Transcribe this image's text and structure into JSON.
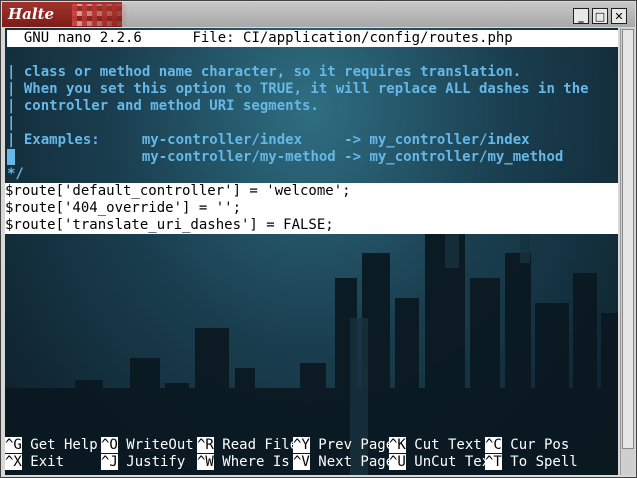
{
  "window": {
    "title": "Halte",
    "min_label": "_",
    "max_label": "□",
    "close_label": "✕"
  },
  "nano": {
    "header_version": "  GNU nano 2.2.6",
    "header_file": "File: CI/application/config/routes.php"
  },
  "comment_lines": [
    "| class or method name character, so it requires translation.",
    "| When you set this option to TRUE, it will replace ALL dashes in the",
    "| controller and method URI segments.",
    "|",
    "| Examples:     my-controller/index     -> my_controller/index",
    "               my-controller/my-method -> my_controller/my_method",
    "*/"
  ],
  "code_lines": [
    "$route['default_controller'] = 'welcome';",
    "$route['404_override'] = '';",
    "$route['translate_uri_dashes'] = FALSE;"
  ],
  "shortcuts_row1": [
    {
      "key": "^G",
      "label": " Get Help"
    },
    {
      "key": "^O",
      "label": " WriteOut"
    },
    {
      "key": "^R",
      "label": " Read File"
    },
    {
      "key": "^Y",
      "label": " Prev Page"
    },
    {
      "key": "^K",
      "label": " Cut Text"
    },
    {
      "key": "^C",
      "label": " Cur Pos"
    }
  ],
  "shortcuts_row2": [
    {
      "key": "^X",
      "label": " Exit"
    },
    {
      "key": "^J",
      "label": " Justify"
    },
    {
      "key": "^W",
      "label": " Where Is"
    },
    {
      "key": "^V",
      "label": " Next Page"
    },
    {
      "key": "^U",
      "label": " UnCut Text"
    },
    {
      "key": "^T",
      "label": " To Spell"
    }
  ],
  "colors": {
    "comment": "#66b8e8",
    "titlebar": "#a0342c"
  }
}
